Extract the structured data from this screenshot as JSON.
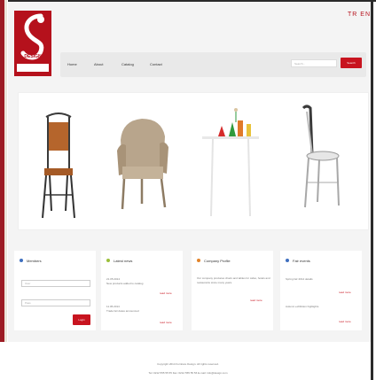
{
  "header": {
    "logo_text": "DESIGN",
    "languages": [
      "TR",
      "EN"
    ]
  },
  "nav": {
    "items": [
      "Home",
      "About",
      "Catalog",
      "Contact"
    ]
  },
  "search": {
    "placeholder": "Search...",
    "button": "Search"
  },
  "banner": {
    "products": [
      "chair-metal-leather",
      "armchair-rattan",
      "table-vases",
      "chair-bistro"
    ]
  },
  "panels": {
    "login": {
      "title": "Members",
      "username_placeholder": "User",
      "password_placeholder": "Pass",
      "button": "Login"
    },
    "news": {
      "title": "Latest news",
      "items": [
        {
          "date": "21.05.2014",
          "text": "New products added to catalog",
          "more": "read more"
        },
        {
          "date": "11.05.2014",
          "text": "Trade fair dates announced",
          "more": "read more"
        }
      ]
    },
    "company": {
      "title": "Company Profile",
      "text": "Our company produces chairs and tables for cafes, hotels and restaurants since many years.",
      "more": "read more"
    },
    "events": {
      "title": "Fair events",
      "items": [
        {
          "text": "Spring fair 2014 details",
          "more": "read more"
        },
        {
          "text": "Autumn exhibition highlights",
          "more": "read more"
        }
      ]
    }
  },
  "footer": {
    "copyright": "Copyright 2014 Furniture Design. All rights reserved.",
    "contact": "Tel: 0212 555 55 55 Fax: 0212 555 55 56 E-mail: info@design.com"
  },
  "colors": {
    "brand": "#b5111c",
    "accent": "#c8141f"
  }
}
